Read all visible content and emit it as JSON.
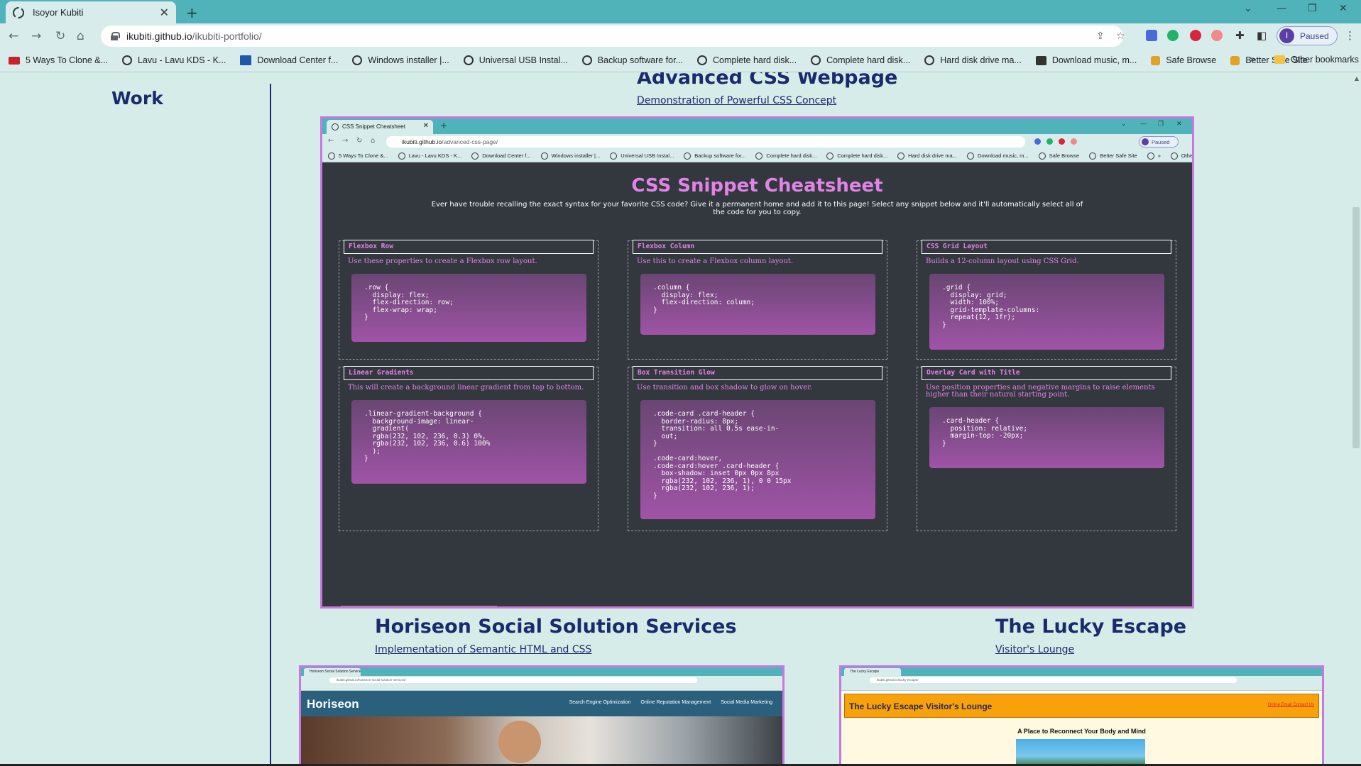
{
  "browser": {
    "tab_title": "Isoyor Kubiti",
    "url_host": "ikubiti.github.io",
    "url_path": "/ikubiti-portfolio/",
    "profile_initial": "I",
    "profile_label": "Paused",
    "bookmarks": [
      {
        "label": "5 Ways To Clone &...",
        "icon": "red-icon"
      },
      {
        "label": "Lavu - Lavu KDS - K...",
        "icon": "globe-icon"
      },
      {
        "label": "Download Center f...",
        "icon": "blue-icon"
      },
      {
        "label": "Windows installer |...",
        "icon": "globe-icon"
      },
      {
        "label": "Universal USB Instal...",
        "icon": "globe-icon"
      },
      {
        "label": "Backup software for...",
        "icon": "globe-icon"
      },
      {
        "label": "Complete hard disk...",
        "icon": "globe-icon"
      },
      {
        "label": "Complete hard disk...",
        "icon": "globe-icon"
      },
      {
        "label": "Hard disk drive ma...",
        "icon": "globe-icon"
      },
      {
        "label": "Download music, m...",
        "icon": "film-icon"
      },
      {
        "label": "Safe Browse",
        "icon": "lock-icon"
      },
      {
        "label": "Better Safe Site",
        "icon": "lock-icon"
      }
    ],
    "bookmarks_more": "»",
    "other_bookmarks": "Other bookmarks"
  },
  "page": {
    "sidebar_heading": "Work",
    "projects": [
      {
        "title": "Advanced CSS Webpage",
        "link": "Demonstration of Powerful CSS Concept"
      },
      {
        "title": "Horiseon Social Solution Services",
        "link": "Implementation of Semantic HTML and CSS"
      },
      {
        "title": "The Lucky Escape",
        "link": "Visitor's Lounge"
      }
    ]
  },
  "screenshot_main": {
    "tab_title": "CSS Snippet Cheatsheet",
    "url_host": "ikubiti.github.io",
    "url_path": "/advanced-css-page/",
    "profile_label": "Paused",
    "bookmarks": [
      "5 Ways To Clone &...",
      "Lavu - Lavu KDS - K...",
      "Download Center f...",
      "Windows installer |...",
      "Universal USB Instal...",
      "Backup software for...",
      "Complete hard disk...",
      "Complete hard disk...",
      "Hard disk drive ma...",
      "Download music, m...",
      "Safe Browse",
      "Better Safe Site",
      "»",
      "Other bookmarks"
    ],
    "heading": "CSS Snippet Cheatsheet",
    "description": "Ever have trouble recalling the exact syntax for your favorite CSS code? Give it a permanent home and add it to this page! Select any snippet below and it'll automatically select all of the code for you to copy.",
    "cards": [
      {
        "header": "Flexbox Row",
        "desc": "Use these properties to create a Flexbox row layout.",
        "code": ".row {\n  display: flex;\n  flex-direction: row;\n  flex-wrap: wrap;\n}"
      },
      {
        "header": "Flexbox Column",
        "desc": "Use this to create a Flexbox column layout.",
        "code": ".column {\n  display: flex;\n  flex-direction: column;\n}"
      },
      {
        "header": "CSS Grid Layout",
        "desc": "Builds a 12-column layout using CSS Grid.",
        "code": ".grid {\n  display: grid;\n  width: 100%;\n  grid-template-columns:\n  repeat(12, 1fr);\n}"
      },
      {
        "header": "Linear Gradients",
        "desc": "This will create a background linear gradient from top to bottom.",
        "code": ".linear-gradient-background {\n  background-image: linear-\n  gradient(\n  rgba(232, 102, 236, 0.3) 0%,\n  rgba(232, 102, 236, 0.6) 100%\n  );\n}"
      },
      {
        "header": "Box Transition Glow",
        "desc": "Use transition and box shadow to glow on hover.",
        "code": ".code-card .card-header {\n  border-radius: 8px;\n  transition: all 0.5s ease-in-\n  out;\n}\n\n.code-card:hover,\n.code-card:hover .card-header {\n  box-shadow: inset 0px 0px 8px\n  rgba(232, 102, 236, 1), 0 0 15px\n  rgba(232, 102, 236, 1);\n}"
      },
      {
        "header": "Overlay Card with Title",
        "desc": "Use position properties and negative margins to raise elements higher than their natural starting point.",
        "code": ".card-header {\n  position: relative;\n  margin-top: -20px;\n}"
      }
    ]
  },
  "screenshot_horiseon": {
    "tab_title": "Horiseon Social Solution Services",
    "url": "ikubiti.github.io/horiseon-social-solution-services/",
    "logo": "Horiseon",
    "nav": [
      "Search Engine Optimization",
      "Online Reputation Management",
      "Social Media Marketing"
    ]
  },
  "screenshot_lucky": {
    "tab_title": "The Lucky Escape",
    "url": "ikubiti.github.io/lucky-escape/",
    "title": "The Lucky Escape Visitor's Lounge",
    "nav": "Online Email Contact Us",
    "subtitle": "A Place to Reconnect Your Body and Mind"
  }
}
